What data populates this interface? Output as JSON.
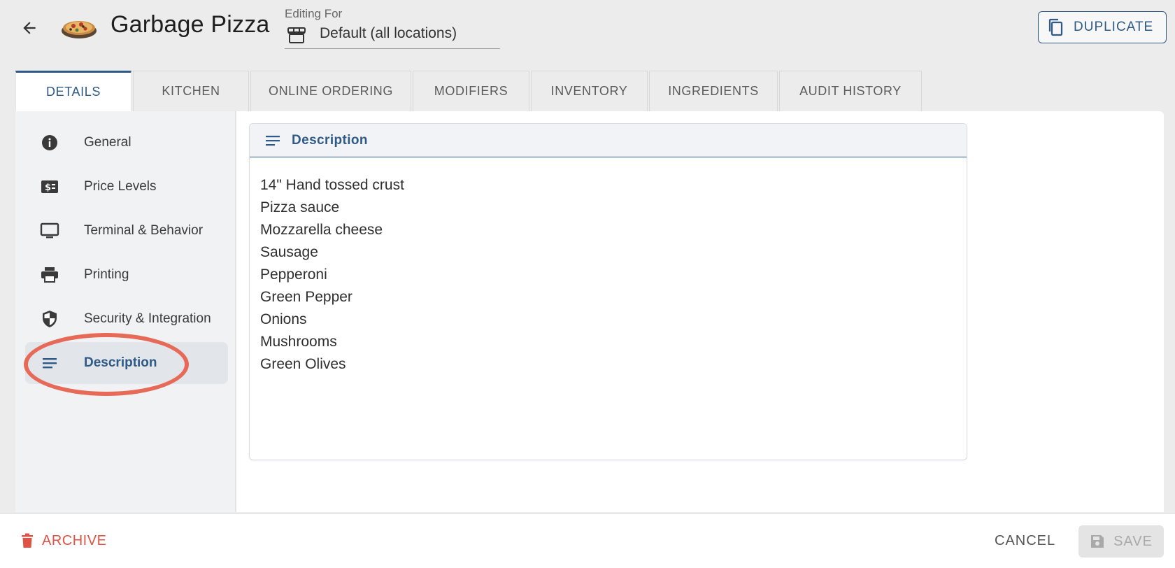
{
  "header": {
    "title": "Garbage Pizza",
    "editing_for_label": "Editing For",
    "editing_for_value": "Default (all locations)",
    "duplicate_label": "DUPLICATE"
  },
  "tabs": [
    {
      "label": "DETAILS",
      "active": true
    },
    {
      "label": "KITCHEN",
      "active": false
    },
    {
      "label": "ONLINE ORDERING",
      "active": false
    },
    {
      "label": "MODIFIERS",
      "active": false
    },
    {
      "label": "INVENTORY",
      "active": false
    },
    {
      "label": "INGREDIENTS",
      "active": false
    },
    {
      "label": "AUDIT HISTORY",
      "active": false
    }
  ],
  "sidebar": {
    "items": [
      {
        "label": "General",
        "icon": "info-icon"
      },
      {
        "label": "Price Levels",
        "icon": "dollar-card-icon"
      },
      {
        "label": "Terminal & Behavior",
        "icon": "monitor-icon"
      },
      {
        "label": "Printing",
        "icon": "printer-icon"
      },
      {
        "label": "Security & Integration",
        "icon": "shield-icon"
      },
      {
        "label": "Description",
        "icon": "lines-icon",
        "selected": true
      }
    ]
  },
  "description": {
    "title": "Description",
    "lines": [
      "14\" Hand tossed crust",
      "Pizza sauce",
      "Mozzarella cheese",
      "Sausage",
      "Pepperoni",
      "Green Pepper",
      "Onions",
      "Mushrooms",
      "Green Olives"
    ]
  },
  "footer": {
    "archive_label": "ARCHIVE",
    "cancel_label": "CANCEL",
    "save_label": "SAVE"
  },
  "colors": {
    "accent": "#2f5a86",
    "danger": "#e05245",
    "highlight_ring": "#e66a57"
  }
}
